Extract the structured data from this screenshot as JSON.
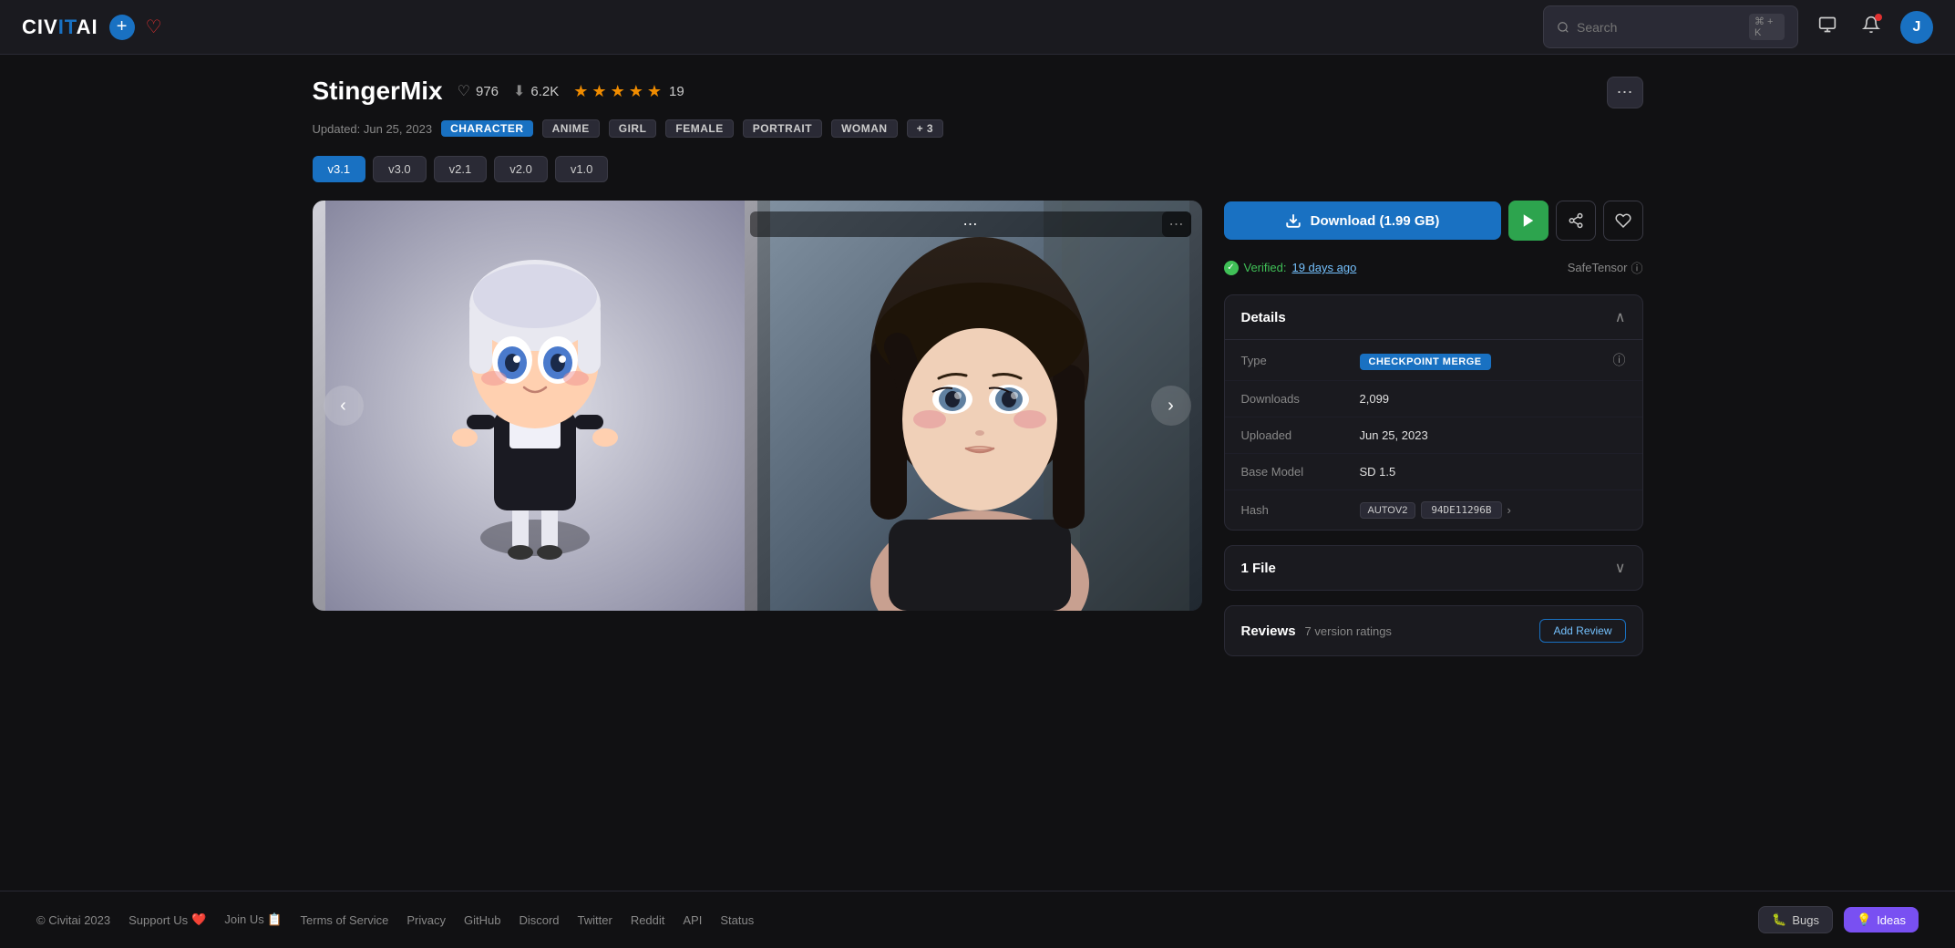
{
  "logo": {
    "text": "CIVITAI",
    "civ": "CIV",
    "it": "IT",
    "ai": "AI"
  },
  "header": {
    "search_placeholder": "Search",
    "search_kbd": "⌘ + K",
    "avatar_initial": "J"
  },
  "model": {
    "title": "StingerMix",
    "likes": "976",
    "downloads": "6.2K",
    "rating_count": "19",
    "stars": 5,
    "updated": "Updated: Jun 25, 2023",
    "tags": [
      "CHARACTER",
      "ANIME",
      "GIRL",
      "FEMALE",
      "PORTRAIT",
      "WOMAN"
    ],
    "tags_more": "+ 3",
    "versions": [
      "v3.1",
      "v3.0",
      "v2.1",
      "v2.0",
      "v1.0"
    ],
    "active_version": "v3.1"
  },
  "download": {
    "label": "Download (1.99 GB)"
  },
  "verified": {
    "text": "Verified:",
    "date": "19 days ago",
    "safetensor": "SafeTensor"
  },
  "details": {
    "title": "Details",
    "type_label": "Type",
    "type_value": "CHECKPOINT MERGE",
    "downloads_label": "Downloads",
    "downloads_value": "2,099",
    "uploaded_label": "Uploaded",
    "uploaded_value": "Jun 25, 2023",
    "base_model_label": "Base Model",
    "base_model_value": "SD 1.5",
    "hash_label": "Hash",
    "hash_type": "AUTOV2",
    "hash_value": "94DE11296B"
  },
  "files": {
    "title": "1 File"
  },
  "reviews": {
    "title": "Reviews",
    "count": "7 version ratings",
    "add_review": "Add Review"
  },
  "footer": {
    "copyright": "© Civitai 2023",
    "support_us": "Support Us",
    "support_icon": "❤️",
    "join_us": "Join Us",
    "join_icon": "📋",
    "terms": "Terms of Service",
    "privacy": "Privacy",
    "github": "GitHub",
    "discord": "Discord",
    "twitter": "Twitter",
    "reddit": "Reddit",
    "api": "API",
    "status": "Status",
    "bugs": "Bugs",
    "bugs_icon": "🐛",
    "ideas": "Ideas",
    "ideas_icon": "💡"
  }
}
